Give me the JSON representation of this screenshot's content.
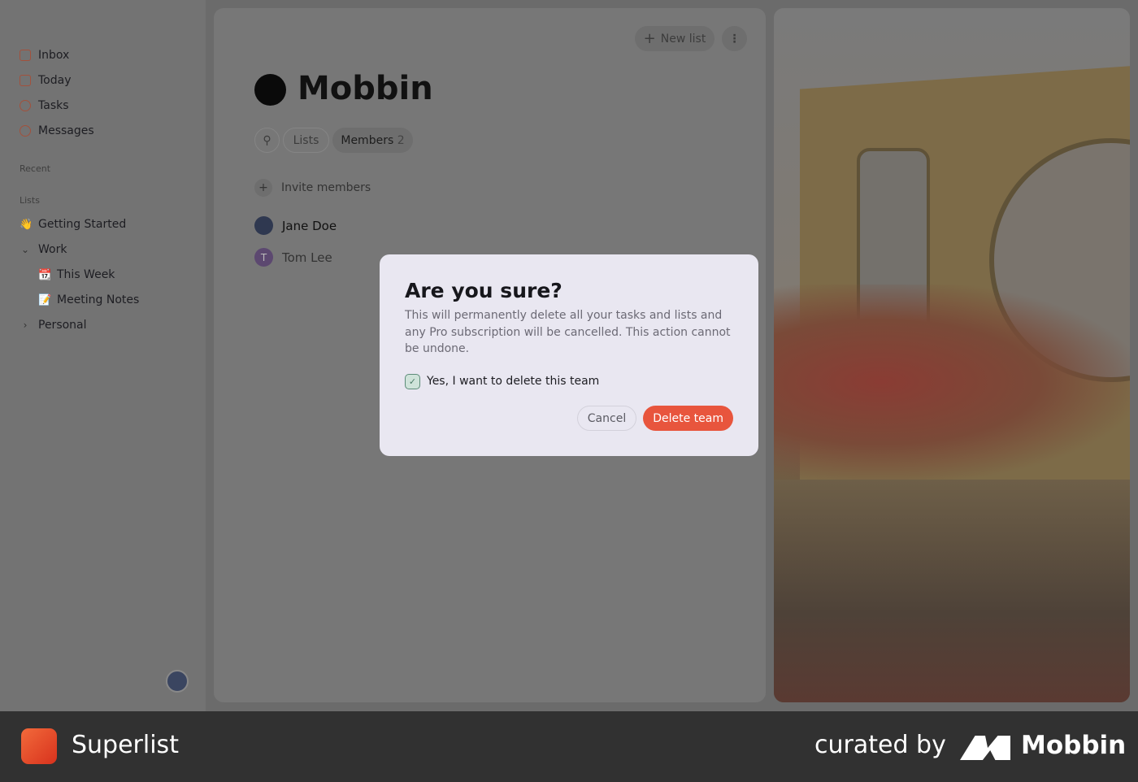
{
  "sidebar": {
    "nav": [
      {
        "label": "Inbox",
        "icon": "inbox-icon"
      },
      {
        "label": "Today",
        "icon": "calendar-icon"
      },
      {
        "label": "Tasks",
        "icon": "tasks-icon"
      },
      {
        "label": "Messages",
        "icon": "messages-icon"
      }
    ],
    "recent_label": "Recent",
    "lists_label": "Lists",
    "lists": [
      {
        "label": "Getting Started",
        "emoji": "👋"
      },
      {
        "label": "Work"
      },
      {
        "label": "This Week",
        "emoji": "📆"
      },
      {
        "label": "Meeting Notes",
        "emoji": "📝"
      },
      {
        "label": "Personal"
      }
    ]
  },
  "main": {
    "new_list": "New list",
    "title": "Mobbin",
    "tabs": {
      "lists": "Lists",
      "members": "Members",
      "members_count": "2"
    },
    "invite": "Invite members",
    "members": [
      {
        "name": "Jane Doe"
      },
      {
        "name": "Tom Lee",
        "initial": "T"
      }
    ]
  },
  "modal": {
    "title": "Are you sure?",
    "body": "This will permanently delete all your tasks and lists and any Pro subscription will be cancelled. This action cannot be undone.",
    "checkbox_label": "Yes, I want to delete this team",
    "checkbox_checked": true,
    "cancel": "Cancel",
    "confirm": "Delete team",
    "accent": "#e8553d"
  },
  "footer": {
    "app": "Superlist",
    "curated": "curated by",
    "brand": "Mobbin"
  }
}
